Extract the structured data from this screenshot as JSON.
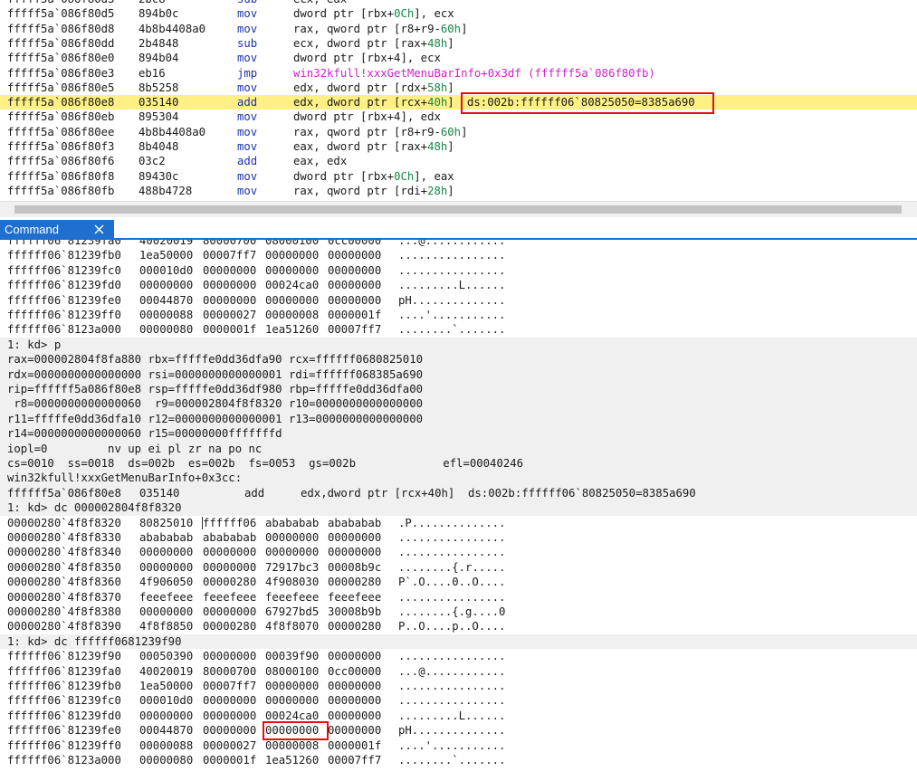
{
  "disasm": {
    "lines": [
      {
        "addr": "fffff5a`086f80d3",
        "bytes": "2bc8",
        "mn": "sub",
        "op": [
          [
            "ecx, eax",
            ""
          ]
        ]
      },
      {
        "addr": "fffff5a`086f80d5",
        "bytes": "894b0c",
        "mn": "mov",
        "op": [
          [
            "dword ptr [rbx+",
            ""
          ],
          [
            "0Ch",
            "g"
          ],
          [
            "], ecx",
            ""
          ]
        ]
      },
      {
        "addr": "fffff5a`086f80d8",
        "bytes": "4b8b4408a0",
        "mn": "mov",
        "op": [
          [
            "rax, qword ptr [r8+r9-",
            ""
          ],
          [
            "60h",
            "g"
          ],
          [
            "]",
            ""
          ]
        ]
      },
      {
        "addr": "fffff5a`086f80dd",
        "bytes": "2b4848",
        "mn": "sub",
        "op": [
          [
            "ecx, dword ptr [rax+",
            ""
          ],
          [
            "48h",
            "g"
          ],
          [
            "]",
            ""
          ]
        ]
      },
      {
        "addr": "fffff5a`086f80e0",
        "bytes": "894b04",
        "mn": "mov",
        "op": [
          [
            "dword ptr [rbx+4], ecx",
            ""
          ]
        ]
      },
      {
        "addr": "fffff5a`086f80e3",
        "bytes": "eb16",
        "mn": "jmp",
        "op": [
          [
            "win32kfull!xxxGetMenuBarInfo+0x3df (ffffff5a`086f80fb)",
            "m"
          ]
        ]
      },
      {
        "addr": "fffff5a`086f80e5",
        "bytes": "8b5258",
        "mn": "mov",
        "op": [
          [
            "edx, dword ptr [rdx+",
            ""
          ],
          [
            "58h",
            "g"
          ],
          [
            "]",
            ""
          ]
        ]
      },
      {
        "addr": "fffff5a`086f80e8",
        "bytes": "035140",
        "mn": "add",
        "op": [
          [
            "edx, dword ptr [rcx+",
            ""
          ],
          [
            "40h",
            "g"
          ],
          [
            "]",
            ""
          ]
        ],
        "ea": "ds:002b:ffffff06`80825050=8385a690",
        "current": true
      },
      {
        "addr": "fffff5a`086f80eb",
        "bytes": "895304",
        "mn": "mov",
        "op": [
          [
            "dword ptr [rbx+4], edx",
            ""
          ]
        ]
      },
      {
        "addr": "fffff5a`086f80ee",
        "bytes": "4b8b4408a0",
        "mn": "mov",
        "op": [
          [
            "rax, qword ptr [r8+r9-",
            ""
          ],
          [
            "60h",
            "g"
          ],
          [
            "]",
            ""
          ]
        ]
      },
      {
        "addr": "fffff5a`086f80f3",
        "bytes": "8b4048",
        "mn": "mov",
        "op": [
          [
            "eax, dword ptr [rax+",
            ""
          ],
          [
            "48h",
            "g"
          ],
          [
            "]",
            ""
          ]
        ]
      },
      {
        "addr": "fffff5a`086f80f6",
        "bytes": "03c2",
        "mn": "add",
        "op": [
          [
            "eax, edx",
            ""
          ]
        ]
      },
      {
        "addr": "fffff5a`086f80f8",
        "bytes": "89430c",
        "mn": "mov",
        "op": [
          [
            "dword ptr [rbx+",
            ""
          ],
          [
            "0Ch",
            "g"
          ],
          [
            "], eax",
            ""
          ]
        ]
      },
      {
        "addr": "fffff5a`086f80fb",
        "bytes": "488b4728",
        "mn": "mov",
        "op": [
          [
            "rax, qword ptr [rdi+",
            ""
          ],
          [
            "28h",
            "g"
          ],
          [
            "]",
            ""
          ]
        ]
      }
    ]
  },
  "command_tab": {
    "label": "Command"
  },
  "command": {
    "top_block": [
      {
        "a": "ffffff06`81239fa0",
        "v": [
          "40020019",
          "80000700",
          "08000100",
          "0cc00000"
        ],
        "as": "...@............"
      },
      {
        "a": "ffffff06`81239fb0",
        "v": [
          "1ea50000",
          "00007ff7",
          "00000000",
          "00000000"
        ],
        "as": "................"
      },
      {
        "a": "ffffff06`81239fc0",
        "v": [
          "000010d0",
          "00000000",
          "00000000",
          "00000000"
        ],
        "as": "................"
      },
      {
        "a": "ffffff06`81239fd0",
        "v": [
          "00000000",
          "00000000",
          "00024ca0",
          "00000000"
        ],
        "as": ".........L......"
      },
      {
        "a": "ffffff06`81239fe0",
        "v": [
          "00044870",
          "00000000",
          "00000000",
          "00000000"
        ],
        "as": "pH.............."
      },
      {
        "a": "ffffff06`81239ff0",
        "v": [
          "00000088",
          "00000027",
          "00000008",
          "0000001f"
        ],
        "as": "....'..........."
      },
      {
        "a": "ffffff06`8123a000",
        "v": [
          "00000080",
          "0000001f",
          "1ea51260",
          "00007ff7"
        ],
        "as": "........`......."
      }
    ],
    "prompt_p": "1: kd> p",
    "regs": [
      "rax=000002804f8fa880 rbx=fffffe0dd36dfa90 rcx=ffffff0680825010",
      "rdx=0000000000000000 rsi=0000000000000001 rdi=ffffff068385a690",
      "rip=ffffff5a086f80e8 rsp=fffffe0dd36df980 rbp=fffffe0dd36dfa00",
      " r8=0000000000000060  r9=000002804f8f8320 r10=0000000000000000",
      "r11=fffffe0dd36dfa10 r12=0000000000000001 r13=0000000000000000",
      "r14=0000000000000060 r15=00000000fffffffd",
      "iopl=0         nv up ei pl zr na po nc",
      "cs=0010  ss=0018  ds=002b  es=002b  fs=0053  gs=002b             efl=00040246",
      "win32kfull!xxxGetMenuBarInfo+0x3cc:"
    ],
    "cur_instr": {
      "addr": "ffffff5a`086f80e8",
      "bytes": "035140",
      "mn": "add",
      "op": "edx,dword ptr [rcx+40h]",
      "ea": "ds:002b:ffffff06`80825050=8385a690"
    },
    "prompt_dc1": "1: kd> dc 000002804f8f8320",
    "dc1": [
      {
        "a": "00000280`4f8f8320",
        "v": [
          "80825010",
          "ffffff06",
          "abababab",
          "abababab"
        ],
        "as": ".P.............."
      },
      {
        "a": "00000280`4f8f8330",
        "v": [
          "abababab",
          "abababab",
          "00000000",
          "00000000"
        ],
        "as": "................"
      },
      {
        "a": "00000280`4f8f8340",
        "v": [
          "00000000",
          "00000000",
          "00000000",
          "00000000"
        ],
        "as": "................"
      },
      {
        "a": "00000280`4f8f8350",
        "v": [
          "00000000",
          "00000000",
          "72917bc3",
          "00008b9c"
        ],
        "as": "........{.r....."
      },
      {
        "a": "00000280`4f8f8360",
        "v": [
          "4f906050",
          "00000280",
          "4f908030",
          "00000280"
        ],
        "as": "P`.O....0..O...."
      },
      {
        "a": "00000280`4f8f8370",
        "v": [
          "feeefeee",
          "feeefeee",
          "feeefeee",
          "feeefeee"
        ],
        "as": "................"
      },
      {
        "a": "00000280`4f8f8380",
        "v": [
          "00000000",
          "00000000",
          "67927bd5",
          "30008b9b"
        ],
        "as": "........{.g....0"
      },
      {
        "a": "00000280`4f8f8390",
        "v": [
          "4f8f8850",
          "00000280",
          "4f8f8070",
          "00000280"
        ],
        "as": "P..O....p..O...."
      }
    ],
    "prompt_dc2": "1: kd> dc ffffff0681239f90",
    "dc2": [
      {
        "a": "ffffff06`81239f90",
        "v": [
          "00050390",
          "00000000",
          "00039f90",
          "00000000"
        ],
        "as": "................"
      },
      {
        "a": "ffffff06`81239fa0",
        "v": [
          "40020019",
          "80000700",
          "08000100",
          "0cc00000"
        ],
        "as": "...@............"
      },
      {
        "a": "ffffff06`81239fb0",
        "v": [
          "1ea50000",
          "00007ff7",
          "00000000",
          "00000000"
        ],
        "as": "................"
      },
      {
        "a": "ffffff06`81239fc0",
        "v": [
          "000010d0",
          "00000000",
          "00000000",
          "00000000"
        ],
        "as": "................"
      },
      {
        "a": "ffffff06`81239fd0",
        "v": [
          "00000000",
          "00000000",
          "00024ca0",
          "00000000"
        ],
        "as": ".........L......"
      },
      {
        "a": "ffffff06`81239fe0",
        "v": [
          "00044870",
          "00000000",
          "00000000",
          "00000000"
        ],
        "as": "pH.............."
      },
      {
        "a": "ffffff06`81239ff0",
        "v": [
          "00000088",
          "00000027",
          "00000008",
          "0000001f"
        ],
        "as": "....'..........."
      },
      {
        "a": "ffffff06`8123a000",
        "v": [
          "00000080",
          "0000001f",
          "1ea51260",
          "00007ff7"
        ],
        "as": "........`......."
      }
    ]
  },
  "colors": {
    "highlight": "#fff086",
    "mnemonic": "#1a33ad",
    "offset": "#16884a",
    "symbol": "#cc22cc",
    "tab": "#1f6fd0",
    "annotation": "#e01010"
  }
}
